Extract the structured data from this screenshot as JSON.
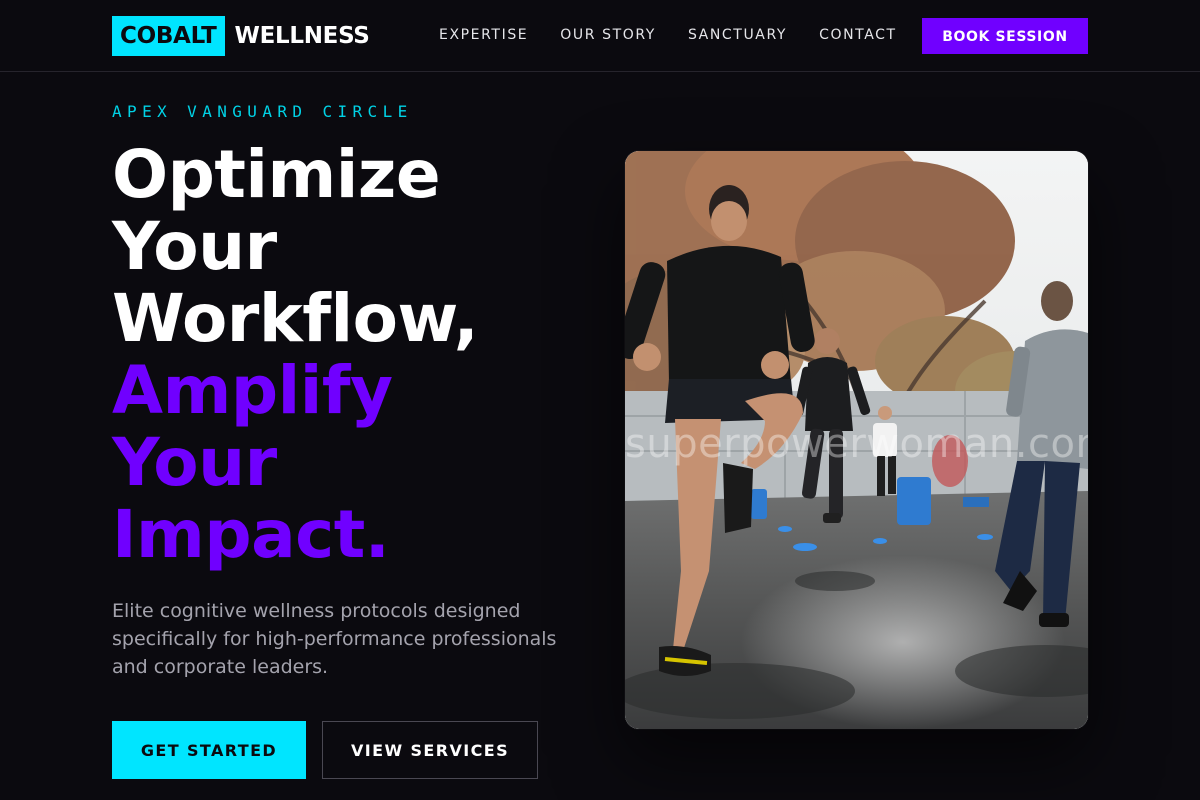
{
  "brand": {
    "badge": "COBALT",
    "word": "WELLNESS"
  },
  "nav": {
    "items": [
      {
        "label": "EXPERTISE"
      },
      {
        "label": "OUR STORY"
      },
      {
        "label": "SANCTUARY"
      },
      {
        "label": "CONTACT"
      }
    ],
    "cta_label": "BOOK SESSION"
  },
  "hero": {
    "eyebrow": "APEX VANGUARD CIRCLE",
    "headline_lines": [
      "Optimize",
      "Your",
      "Workflow,",
      "Amplify",
      "Your",
      "Impact."
    ],
    "lede": "Elite cognitive wellness protocols designed specifically for high-performance professionals and corporate leaders.",
    "primary_label": "GET STARTED",
    "secondary_label": "VIEW SERVICES",
    "image_watermark": "superpowerwoman.com",
    "image_subject": "group-outdoor-running-workout-photo"
  },
  "colors": {
    "background": "#0b0a0f",
    "accent_cyan": "#00e5ff",
    "accent_purple": "#7000ff",
    "text_muted": "#a4a3ad"
  }
}
